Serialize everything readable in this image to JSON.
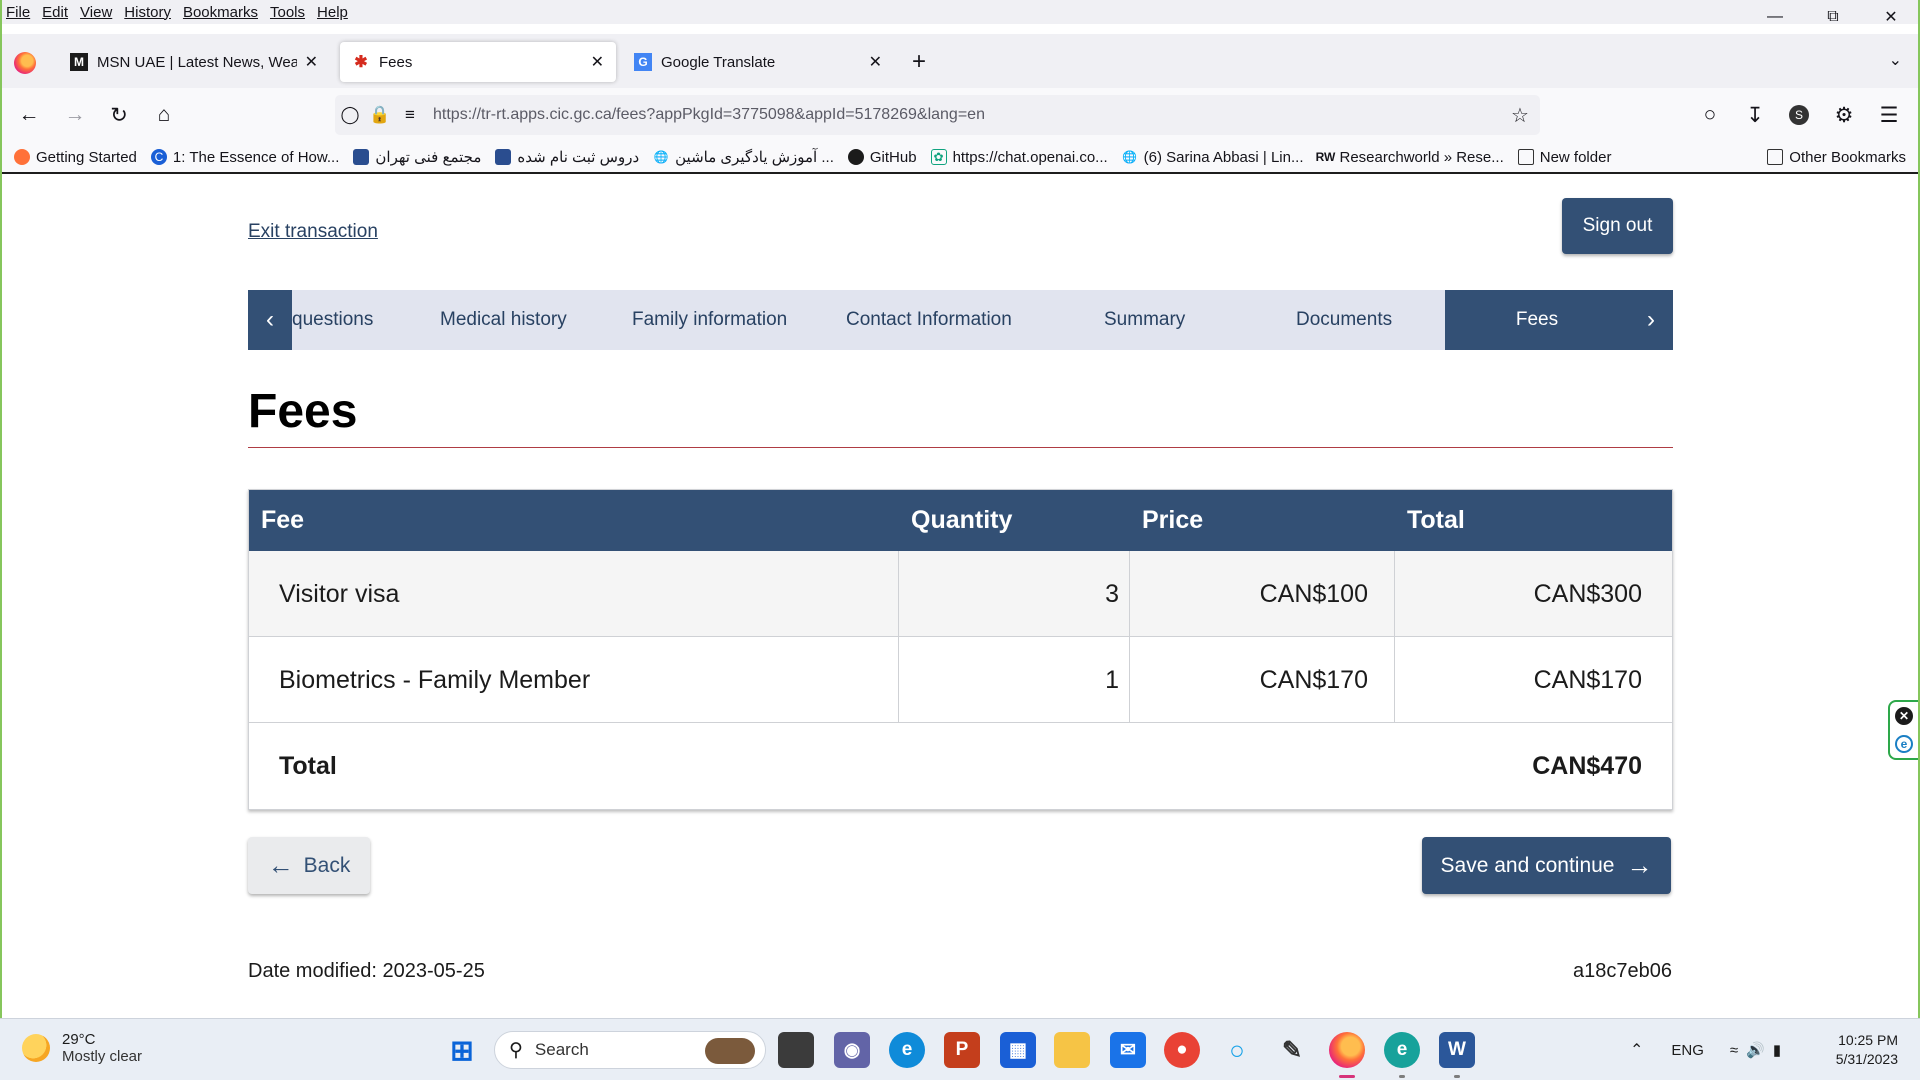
{
  "menu": [
    "File",
    "Edit",
    "View",
    "History",
    "Bookmarks",
    "Tools",
    "Help"
  ],
  "tabs": [
    {
      "title": "MSN UAE | Latest News, Weathe",
      "icon": "msn-icon"
    },
    {
      "title": "Fees",
      "icon": "maple-leaf-icon"
    },
    {
      "title": "Google Translate",
      "icon": "google-translate-icon"
    }
  ],
  "url": "https://tr-rt.apps.cic.gc.ca/fees?appPkgId=3775098&appId=5178269&lang=en",
  "bookmarks": [
    "Getting Started",
    "1: The Essence of How...",
    "مجتمع فنی تهران",
    "دروس ثبت نام شده",
    "آموزش یادگیری ماشین ...",
    "GitHub",
    "https://chat.openai.co...",
    "(6) Sarina Abbasi | Lin...",
    "Researchworld » Rese...",
    "New folder"
  ],
  "other_bookmarks": "Other Bookmarks",
  "page": {
    "exit_link": "Exit transaction",
    "sign_out": "Sign out",
    "steps": [
      "questions",
      "Medical history",
      "Family information",
      "Contact Information",
      "Summary",
      "Documents"
    ],
    "active_step": "Fees",
    "title": "Fees",
    "table": {
      "headers": [
        "Fee",
        "Quantity",
        "Price",
        "Total"
      ],
      "rows": [
        {
          "fee": "Visitor visa",
          "quantity": "3",
          "price": "CAN$100",
          "total": "CAN$300"
        },
        {
          "fee": "Biometrics - Family Member",
          "quantity": "1",
          "price": "CAN$170",
          "total": "CAN$170"
        }
      ],
      "total_label": "Total",
      "total_value": "CAN$470"
    },
    "back_label": "Back",
    "save_label": "Save and continue",
    "date_modified": "Date modified: 2023-05-25",
    "version": "a18c7eb06"
  },
  "taskbar": {
    "temp": "29°C",
    "condition": "Mostly clear",
    "search_placeholder": "Search",
    "lang": "ENG",
    "time": "10:25 PM",
    "date": "5/31/2023"
  },
  "colors": {
    "gc_blue": "#335075",
    "gc_nav_bg": "#e1e4ef",
    "gc_link": "#284162",
    "rule_red": "#af3c43"
  }
}
